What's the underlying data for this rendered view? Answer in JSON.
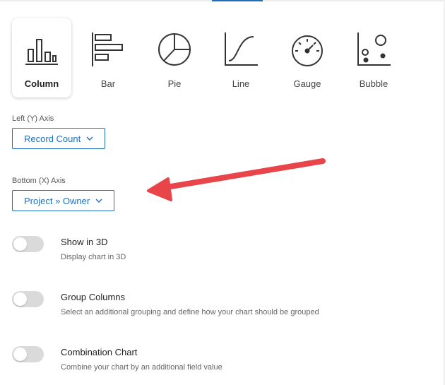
{
  "chart_types": [
    {
      "label": "Column",
      "icon": "column-chart-icon",
      "selected": true
    },
    {
      "label": "Bar",
      "icon": "bar-chart-icon",
      "selected": false
    },
    {
      "label": "Pie",
      "icon": "pie-chart-icon",
      "selected": false
    },
    {
      "label": "Line",
      "icon": "line-chart-icon",
      "selected": false
    },
    {
      "label": "Gauge",
      "icon": "gauge-chart-icon",
      "selected": false
    },
    {
      "label": "Bubble",
      "icon": "bubble-chart-icon",
      "selected": false
    }
  ],
  "left_axis": {
    "label": "Left (Y) Axis",
    "value": "Record Count"
  },
  "bottom_axis": {
    "label": "Bottom (X) Axis",
    "value": "Project » Owner"
  },
  "toggles": [
    {
      "title": "Show in 3D",
      "description": "Display chart in 3D",
      "enabled": false
    },
    {
      "title": "Group Columns",
      "description": "Select an additional grouping and define how your chart should be grouped",
      "enabled": false
    },
    {
      "title": "Combination Chart",
      "description": "Combine your chart by an additional field value",
      "enabled": false
    }
  ],
  "colors": {
    "accent": "#1f6fbf",
    "arrow": "#e8454a",
    "toggle_off": "#dadada"
  }
}
